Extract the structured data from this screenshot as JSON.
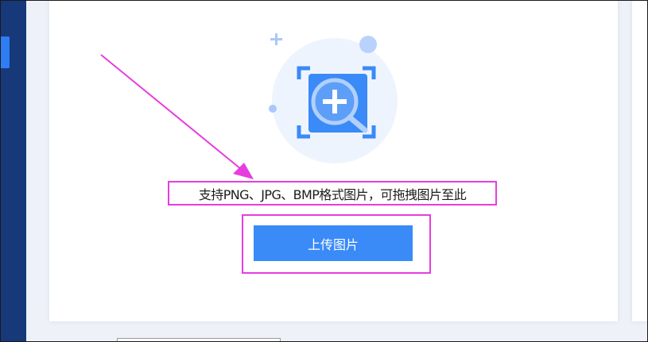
{
  "upload": {
    "hint_text": "支持PNG、JPG、BMP格式图片，可拖拽图片至此",
    "button_label": "上传图片"
  },
  "colors": {
    "sidebar": "#17397a",
    "accent": "#3a8af8",
    "annotation": "#e63ddf"
  },
  "icons": {
    "upload_illustration": "image-zoom-plus-icon",
    "annotation_arrow": "arrow-annotation-icon"
  }
}
